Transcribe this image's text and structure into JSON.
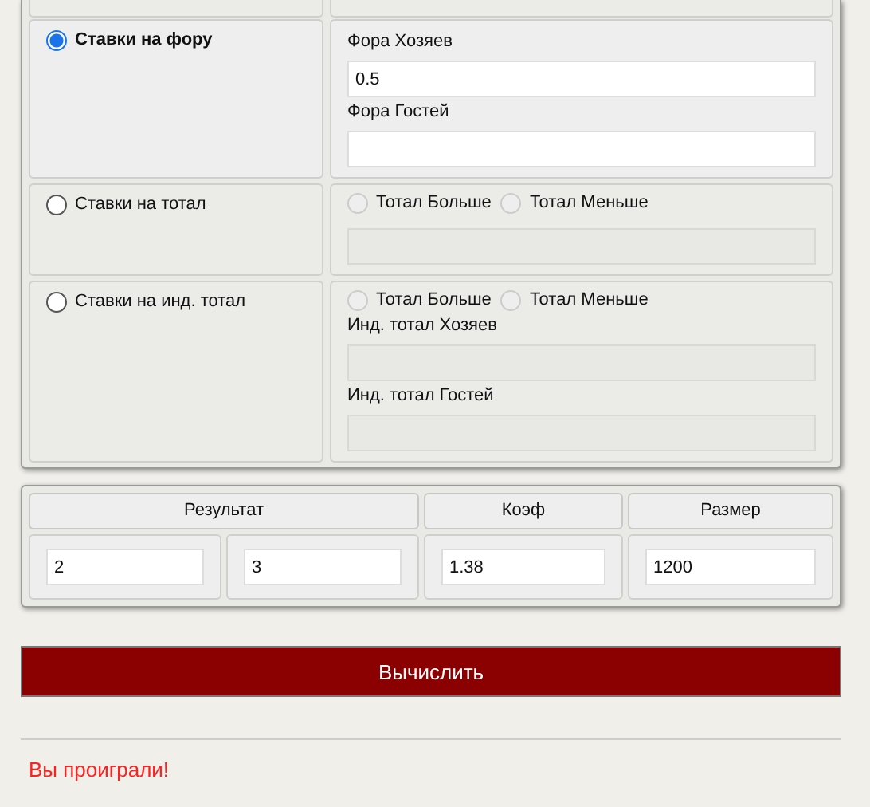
{
  "bet_types": [
    {
      "kind": "handicap",
      "label": "Ставки на фору",
      "selected": true,
      "fields": [
        {
          "label": "Фора Хозяев",
          "value": "0.5",
          "disabled": false
        },
        {
          "label": "Фора Гостей",
          "disabled": false
        }
      ]
    },
    {
      "kind": "total",
      "label": "Ставки на тотал",
      "selected": false,
      "options": [
        {
          "label": "Тотал Больше",
          "selected": false,
          "disabled": true
        },
        {
          "label": "Тотал Меньше",
          "selected": false,
          "disabled": true
        }
      ],
      "fields": [
        {
          "disabled": true
        }
      ]
    },
    {
      "kind": "ind_total",
      "label": "Ставки на инд. тотал",
      "selected": false,
      "options": [
        {
          "label": "Тотал Больше",
          "selected": false,
          "disabled": true
        },
        {
          "label": "Тотал Меньше",
          "selected": false,
          "disabled": true
        }
      ],
      "fields": [
        {
          "label": "Инд. тотал Хозяев",
          "disabled": true
        },
        {
          "label": "Инд. тотал Гостей",
          "disabled": true
        }
      ]
    }
  ],
  "result_table": {
    "columns": [
      "Результат",
      "Коэф",
      "Размер"
    ],
    "values": [
      "2",
      "3",
      "1.38",
      "1200"
    ]
  },
  "calculate_button": "Вычислить",
  "message": "Вы проиграли!"
}
